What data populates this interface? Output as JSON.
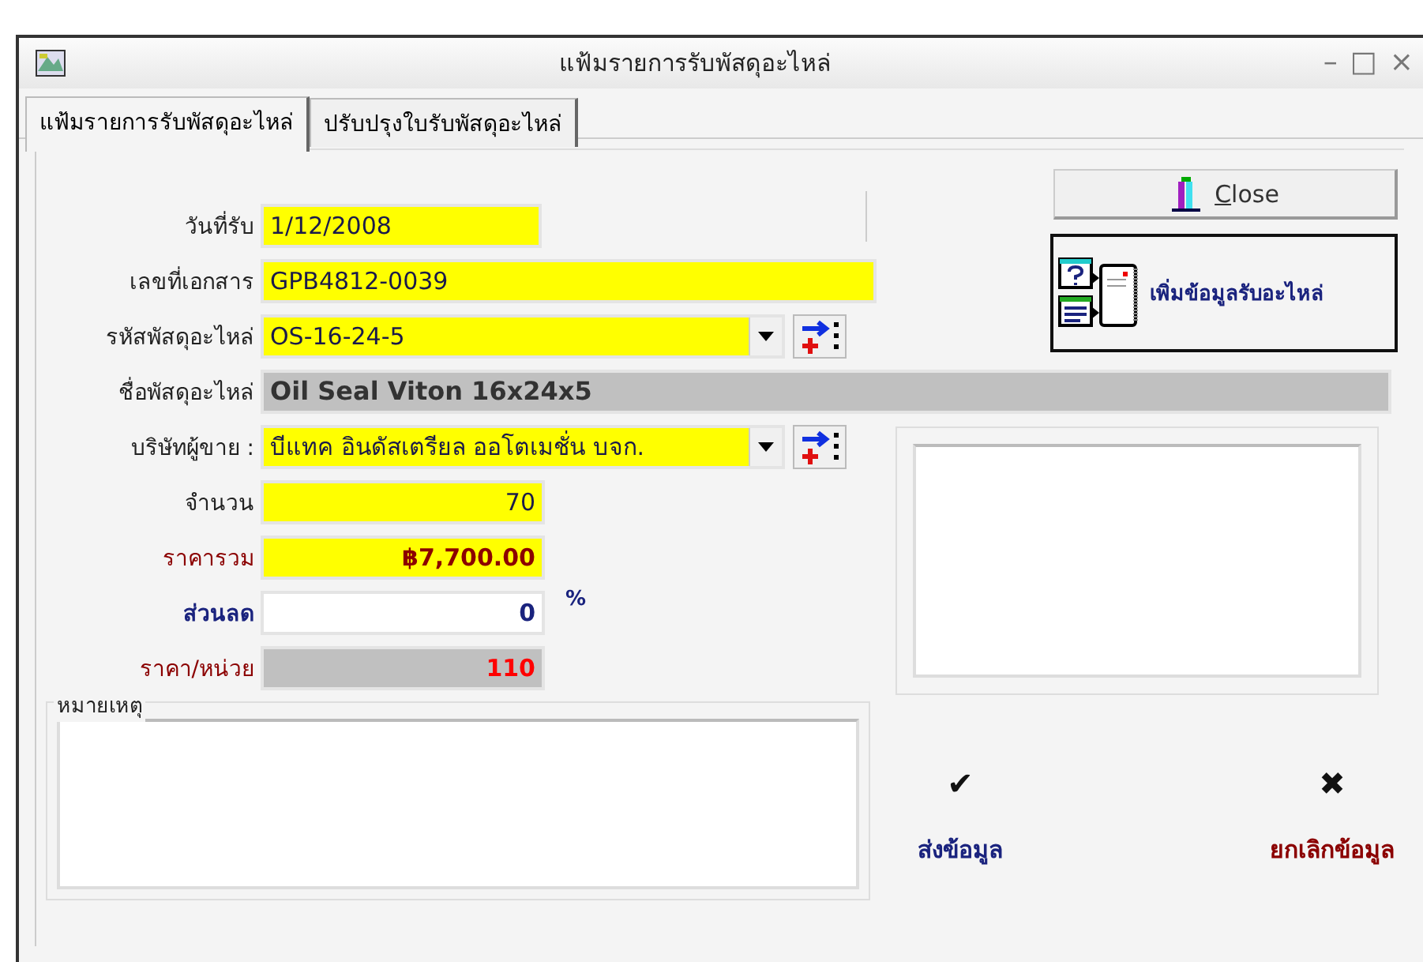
{
  "window": {
    "title": "แฟ้มรายการรับพัสดุอะไหล่",
    "controls": [
      "–",
      "□",
      "×"
    ]
  },
  "tabs": [
    {
      "label": "แฟ้มรายการรับพัสดุอะไหล่",
      "selected": true
    },
    {
      "label": "ปรับปรุงใบรับพัสดุอะไหล่",
      "selected": false
    }
  ],
  "fields": [
    {
      "label": "วันที่รับ",
      "value": "1/12/2008",
      "kind": "date"
    },
    {
      "label": "เลขที่เอกสาร",
      "value": "GPB4812-0039",
      "kind": "text"
    },
    {
      "label": "รหัสพัสดุอะไหล่",
      "value": "OS-16-24-5",
      "kind": "combo"
    },
    {
      "label": "ชื่อพัสดุอะไหล่",
      "value": "Oil Seal Viton 16x24x5",
      "kind": "display"
    },
    {
      "label": "บริษัทผู้ขาย :",
      "value": "บีแทค อินดัสเตรียล ออโตเมชั่น บจก.",
      "kind": "combo"
    },
    {
      "label": "จำนวน",
      "value": "70",
      "kind": "number"
    },
    {
      "label": "ราคารวม",
      "value": "฿7,700.00",
      "kind": "total"
    },
    {
      "label": "ส่วนลด",
      "value": "0",
      "kind": "discount",
      "suffix": "%"
    },
    {
      "label": "ราคา/หน่วย",
      "value": "110",
      "kind": "unit_price"
    }
  ],
  "remarks": {
    "label": "หมายเหตุ"
  },
  "close_button": {
    "label": "Close"
  },
  "add_button": {
    "label": "เพิ่มข้อมูลรับอะไหล่"
  },
  "actions": [
    {
      "icon": "✔",
      "label": "ส่งข้อมูล",
      "kind": "submit"
    },
    {
      "icon": "✖",
      "label": "ยกเลิกข้อมูล",
      "kind": "cancel"
    }
  ]
}
